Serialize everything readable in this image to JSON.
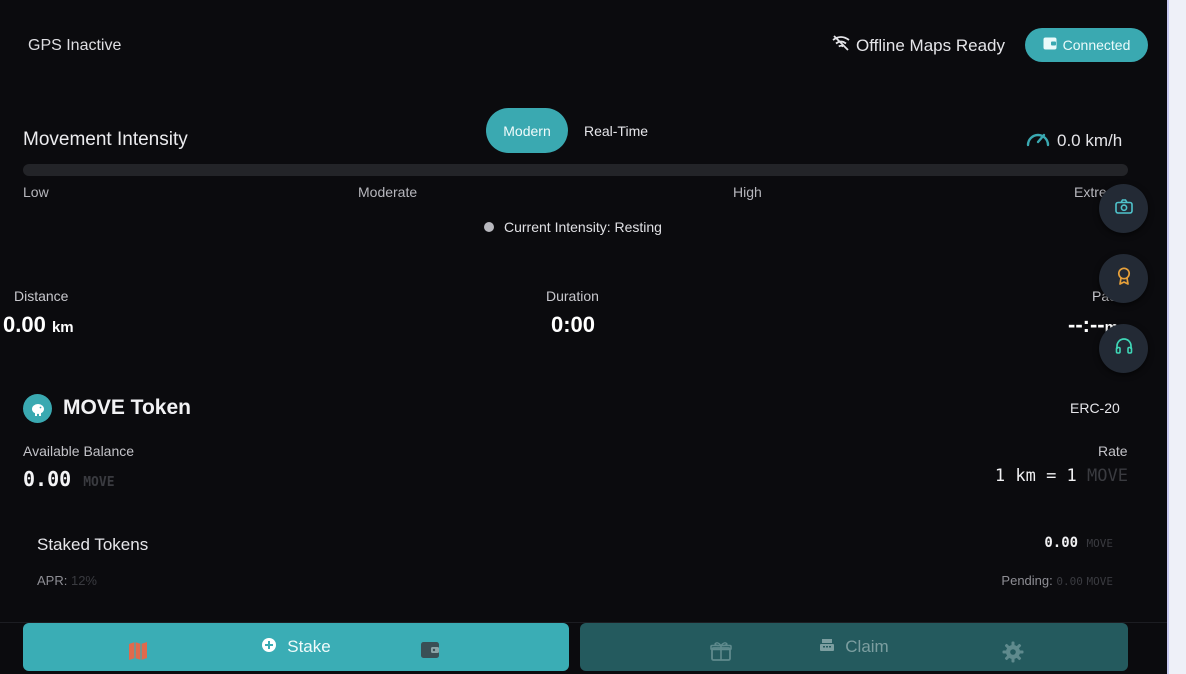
{
  "status": {
    "gps": "GPS Inactive",
    "offline_maps": "Offline Maps Ready",
    "wallet": "Connected"
  },
  "intensity": {
    "title": "Movement Intensity",
    "modes": [
      "Modern",
      "Real-Time"
    ],
    "speed": "0.0 km/h",
    "progress_percent": 0,
    "levels": [
      "Low",
      "Moderate",
      "High",
      "Extre"
    ],
    "current": "Current Intensity: Resting"
  },
  "stats": {
    "distance_label": "Distance",
    "distance_value": "0.00",
    "distance_unit": "km",
    "duration_label": "Duration",
    "duration_value": "0:00",
    "pace_label": "Pac",
    "pace_value": "--:--",
    "pace_unit": "m"
  },
  "token": {
    "title": "MOVE Token",
    "standard": "ERC-20",
    "balance_label": "Available Balance",
    "balance_value": "0.00",
    "balance_unit": "MOVE",
    "rate_label": "Rate",
    "rate_value": "1 km = 1",
    "rate_unit": "MOVE",
    "staked_label": "Staked Tokens",
    "staked_value": "0.00",
    "staked_unit": "MOVE",
    "apr_label": "APR:",
    "apr_value": "12%",
    "pending_label": "Pending:",
    "pending_value": "0.00",
    "pending_unit": "MOVE"
  },
  "actions": {
    "stake": "Stake",
    "claim": "Claim"
  },
  "icons": {
    "wifi_off": "wifi-off-icon",
    "wallet": "wallet-icon",
    "speedometer": "speedometer-icon",
    "camera": "camera-icon",
    "award": "award-icon",
    "headphones": "headphones-icon",
    "token": "piggy-bank-icon",
    "map": "map-icon",
    "plus_circle": "plus-circle-icon",
    "gift": "gift-icon",
    "cash_register": "cash-register-icon",
    "settings": "gear-icon"
  },
  "colors": {
    "accent": "#3aa9b1",
    "background": "#0b0b0e",
    "claim_disabled": "#245a5e",
    "award": "#e8a13a"
  }
}
